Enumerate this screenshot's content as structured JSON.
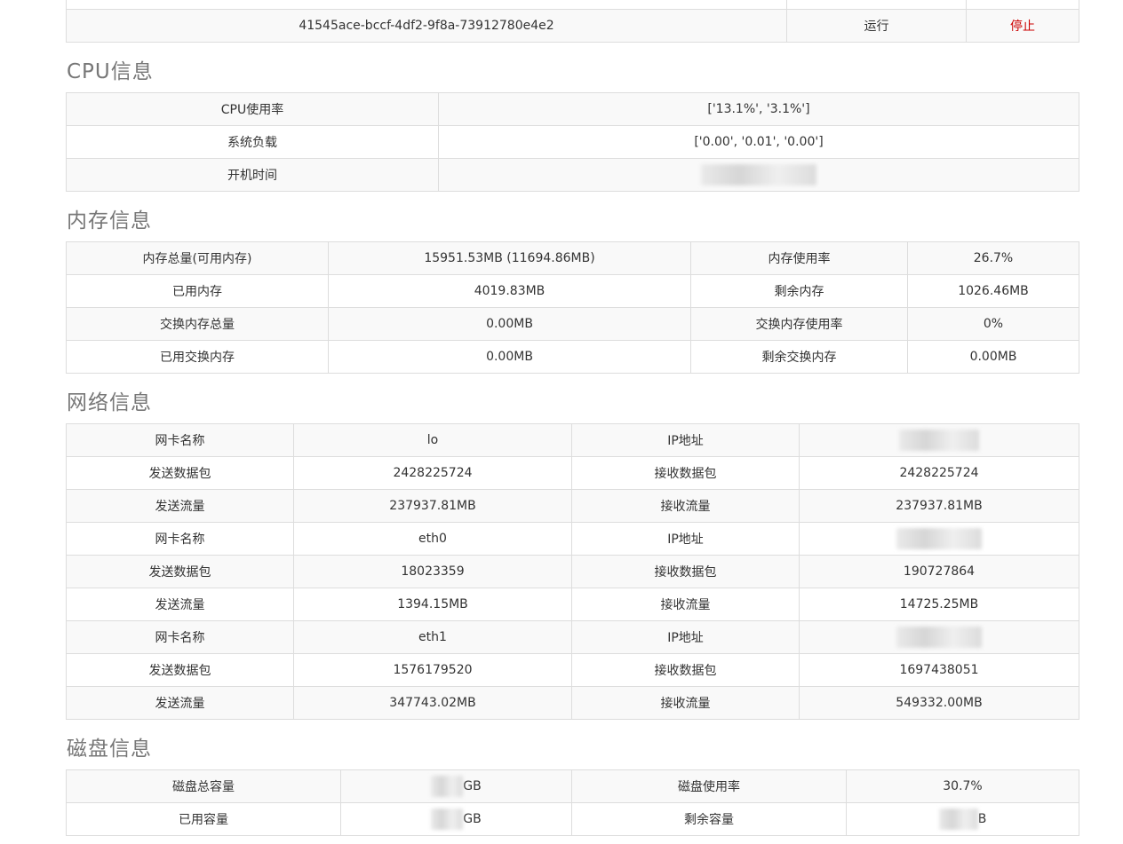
{
  "process_row": {
    "id": "41545ace-bccf-4df2-9f8a-73912780e4e2",
    "status": "运行",
    "action": "停止"
  },
  "cpu": {
    "title": "CPU信息",
    "rows": [
      {
        "label": "CPU使用率",
        "value": "['13.1%', '3.1%']"
      },
      {
        "label": "系统负载",
        "value": "['0.00', '0.01', '0.00']"
      },
      {
        "label": "开机时间",
        "value": ""
      }
    ]
  },
  "memory": {
    "title": "内存信息",
    "rows": [
      {
        "k1": "内存总量(可用内存)",
        "v1": "15951.53MB (11694.86MB)",
        "k2": "内存使用率",
        "v2": "26.7%"
      },
      {
        "k1": "已用内存",
        "v1": "4019.83MB",
        "k2": "剩余内存",
        "v2": "1026.46MB"
      },
      {
        "k1": "交换内存总量",
        "v1": "0.00MB",
        "k2": "交换内存使用率",
        "v2": "0%"
      },
      {
        "k1": "已用交换内存",
        "v1": "0.00MB",
        "k2": "剩余交换内存",
        "v2": "0.00MB"
      }
    ]
  },
  "network": {
    "title": "网络信息",
    "rows": [
      {
        "k1": "网卡名称",
        "v1": "lo",
        "k2": "IP地址",
        "v2": ""
      },
      {
        "k1": "发送数据包",
        "v1": "2428225724",
        "k2": "接收数据包",
        "v2": "2428225724"
      },
      {
        "k1": "发送流量",
        "v1": "237937.81MB",
        "k2": "接收流量",
        "v2": "237937.81MB"
      },
      {
        "k1": "网卡名称",
        "v1": "eth0",
        "k2": "IP地址",
        "v2": ""
      },
      {
        "k1": "发送数据包",
        "v1": "18023359",
        "k2": "接收数据包",
        "v2": "190727864"
      },
      {
        "k1": "发送流量",
        "v1": "1394.15MB",
        "k2": "接收流量",
        "v2": "14725.25MB"
      },
      {
        "k1": "网卡名称",
        "v1": "eth1",
        "k2": "IP地址",
        "v2": ""
      },
      {
        "k1": "发送数据包",
        "v1": "1576179520",
        "k2": "接收数据包",
        "v2": "1697438051"
      },
      {
        "k1": "发送流量",
        "v1": "347743.02MB",
        "k2": "接收流量",
        "v2": "549332.00MB"
      }
    ]
  },
  "disk": {
    "title": "磁盘信息",
    "rows": [
      {
        "k1": "磁盘总容量",
        "v1_suffix": "GB",
        "k2": "磁盘使用率",
        "v2": "30.7%"
      },
      {
        "k1": "已用容量",
        "v1_suffix": "GB",
        "k2": "剩余容量",
        "v2_suffix": "B"
      }
    ]
  }
}
